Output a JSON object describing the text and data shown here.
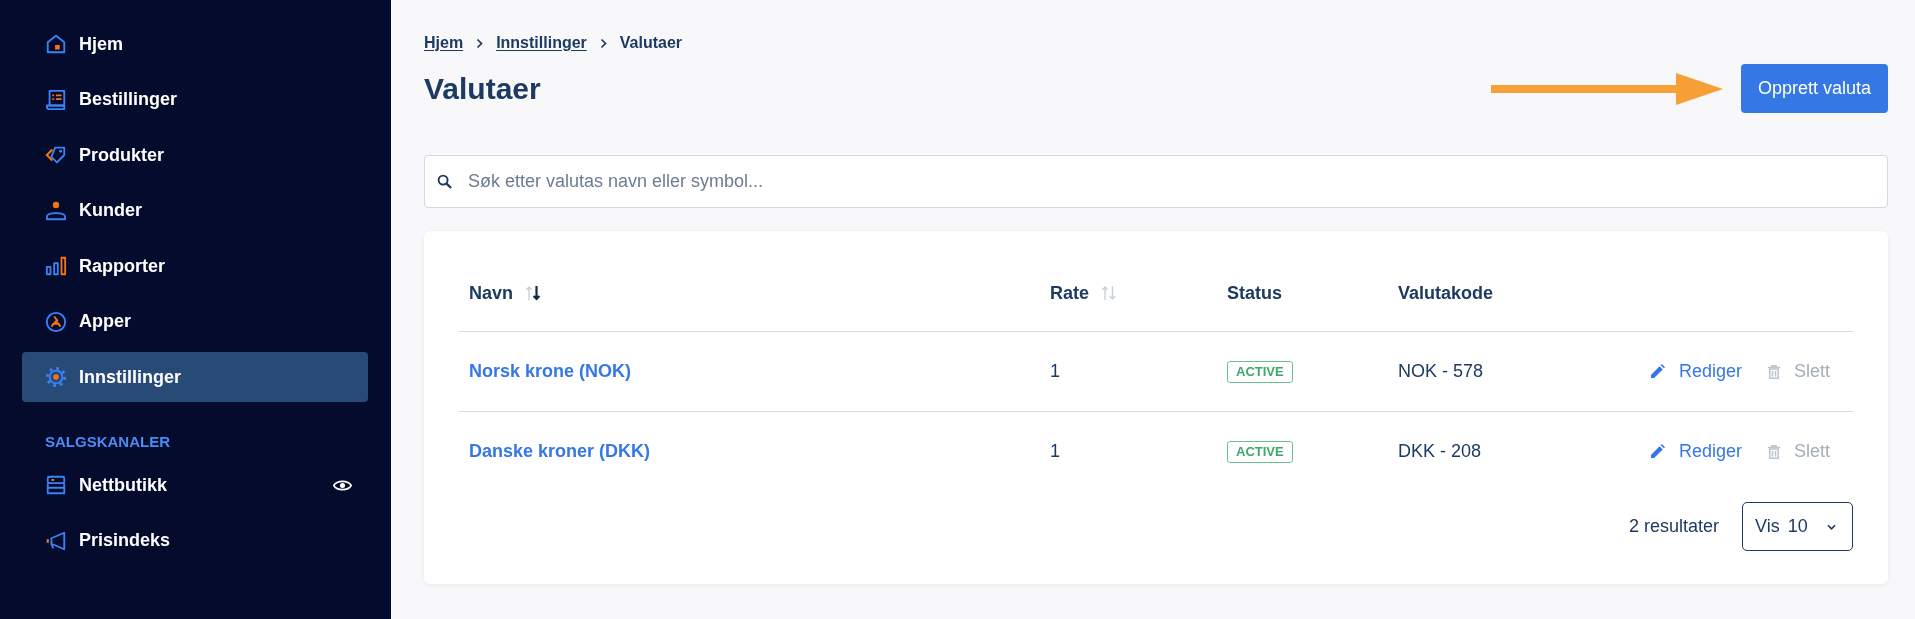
{
  "sidebar": {
    "items": [
      {
        "label": "Hjem",
        "selected": false
      },
      {
        "label": "Bestillinger",
        "selected": false
      },
      {
        "label": "Produkter",
        "selected": false
      },
      {
        "label": "Kunder",
        "selected": false
      },
      {
        "label": "Rapporter",
        "selected": false
      },
      {
        "label": "Apper",
        "selected": false
      },
      {
        "label": "Innstillinger",
        "selected": true
      }
    ],
    "sections": [
      {
        "title": "SALGSKANALER",
        "items": [
          {
            "label": "Nettbutikk",
            "selected": false,
            "preview": true
          },
          {
            "label": "Prisindeks",
            "selected": false,
            "preview": false
          }
        ]
      }
    ]
  },
  "breadcrumb": [
    {
      "label": "Hjem",
      "current": false
    },
    {
      "label": "Innstillinger",
      "current": false
    },
    {
      "label": "Valutaer",
      "current": true
    }
  ],
  "page": {
    "title": "Valutaer",
    "primary_button": "Opprett valuta"
  },
  "search": {
    "placeholder": "Søk etter valutas navn eller symbol..."
  },
  "table": {
    "columns": [
      {
        "label": "Navn",
        "sorted": true
      },
      {
        "label": "Rate",
        "sorted": false
      },
      {
        "label": "Status"
      },
      {
        "label": "Valutakode"
      }
    ],
    "rows": [
      {
        "name": "Norsk krone (NOK)",
        "rate": "1",
        "status": "ACTIVE",
        "code": "NOK - 578",
        "actions": [
          {
            "kind": "edit",
            "label": "Rediger",
            "disabled": false
          },
          {
            "kind": "delete",
            "label": "Slett",
            "disabled": true
          }
        ]
      },
      {
        "name": "Danske kroner (DKK)",
        "rate": "1",
        "status": "ACTIVE",
        "code": "DKK - 208",
        "actions": [
          {
            "kind": "edit",
            "label": "Rediger",
            "disabled": false
          },
          {
            "kind": "delete",
            "label": "Slett",
            "disabled": true
          }
        ]
      }
    ]
  },
  "pagination": {
    "results": "2 resultater",
    "page_size": {
      "label": "Vis",
      "value": "10"
    }
  }
}
